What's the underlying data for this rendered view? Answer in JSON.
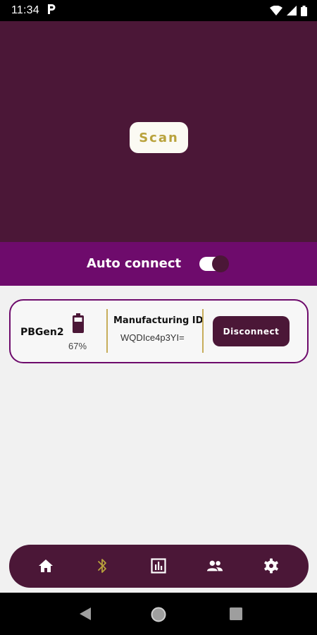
{
  "status_bar": {
    "time": "11:34",
    "notification_letter": "P",
    "icons": [
      "wifi-icon",
      "cell-signal-icon",
      "battery-icon"
    ]
  },
  "scan": {
    "button_label": "Scan"
  },
  "auto_connect": {
    "label": "Auto connect",
    "enabled": true
  },
  "device": {
    "name": "PBGen2",
    "battery_percent": "67%",
    "manufacturing_id_title": "Manufacturing ID",
    "manufacturing_id_value": "WQDIce4p3YI=",
    "disconnect_label": "Disconnect"
  },
  "bottom_nav": {
    "items": [
      {
        "icon": "home-icon",
        "active": false
      },
      {
        "icon": "bluetooth-icon",
        "active": true
      },
      {
        "icon": "chart-icon",
        "active": false
      },
      {
        "icon": "people-icon",
        "active": false
      },
      {
        "icon": "gear-icon",
        "active": false
      }
    ]
  },
  "colors": {
    "primary": "#4b1737",
    "accent_bar": "#6e0b6c",
    "gold": "#b9a23c",
    "background": "#f1f1f1"
  }
}
